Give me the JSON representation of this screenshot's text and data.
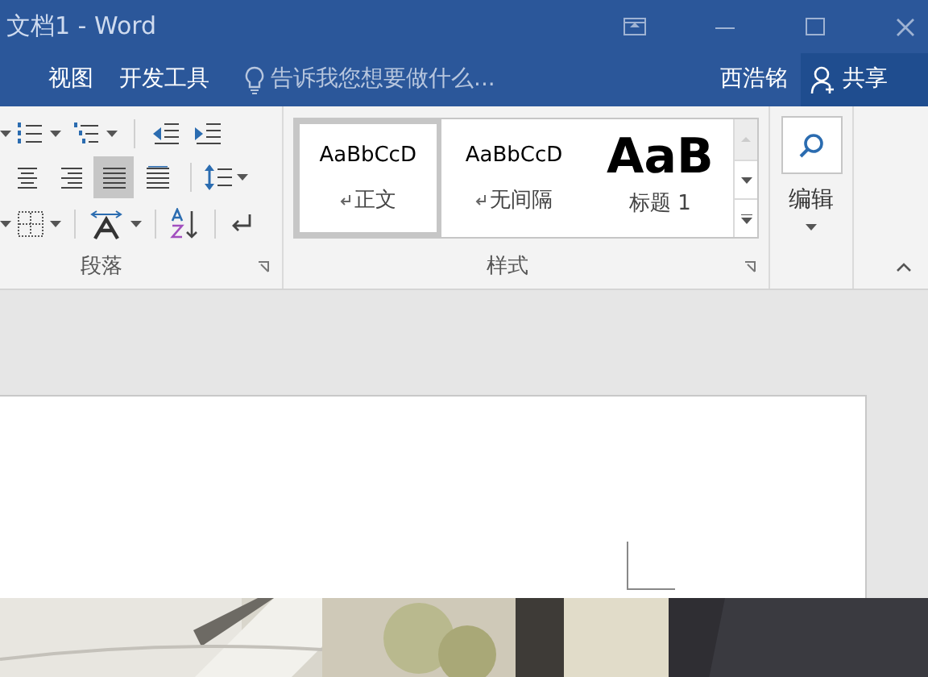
{
  "window": {
    "title": "文档1 - Word"
  },
  "tabs": [
    {
      "label": "视图",
      "selected": false
    },
    {
      "label": "开发工具",
      "selected": false
    }
  ],
  "tell_me": {
    "placeholder": "告诉我您想要做什么..."
  },
  "user": {
    "name": "西浩铭"
  },
  "share_button": {
    "label": "共享"
  },
  "paragraph_group": {
    "label": "段落",
    "alignment": [
      {
        "kind": "center",
        "selected": false
      },
      {
        "kind": "right",
        "selected": false
      },
      {
        "kind": "justify",
        "selected": true
      },
      {
        "kind": "distributed",
        "selected": false
      }
    ]
  },
  "styles_group": {
    "label": "样式",
    "styles": [
      {
        "preview": "AaBbCcD",
        "name": "正文",
        "para_mark": true,
        "selected": true,
        "kind": "normal"
      },
      {
        "preview": "AaBbCcD",
        "name": "无间隔",
        "para_mark": true,
        "selected": false,
        "kind": "normal"
      },
      {
        "preview": "AaB",
        "name": "标题 1",
        "para_mark": false,
        "selected": false,
        "kind": "heading"
      }
    ]
  },
  "editing_group": {
    "label": "编辑"
  }
}
